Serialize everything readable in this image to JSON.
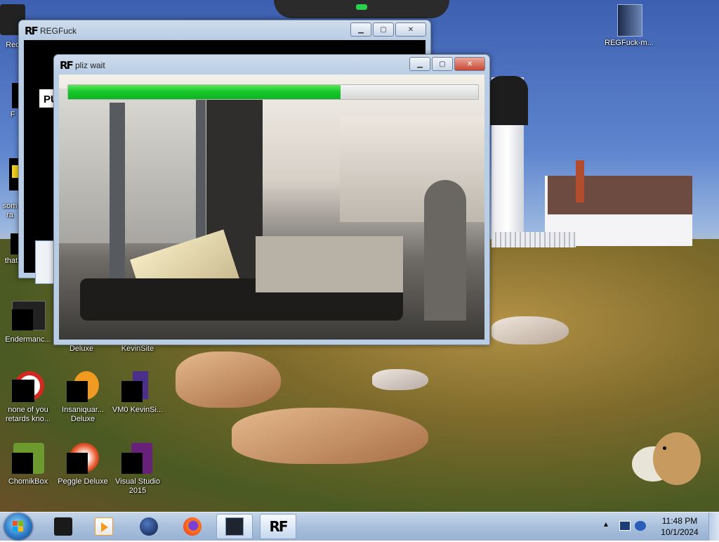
{
  "desktop": {
    "icons": [
      {
        "id": "rec",
        "label": "Rec"
      },
      {
        "id": "f",
        "label": "F"
      },
      {
        "id": "some",
        "label": "som\nra"
      },
      {
        "id": "that",
        "label": "that"
      },
      {
        "id": "enderman",
        "label": "Endermanc..."
      },
      {
        "id": "deluxe-top",
        "label": "Deluxe"
      },
      {
        "id": "kevinsite-top",
        "label": "KevinSite"
      },
      {
        "id": "none-of-you",
        "label": "none of you retards kno..."
      },
      {
        "id": "insaniquarium",
        "label": "Insaniquar... Deluxe"
      },
      {
        "id": "vm0",
        "label": "VM0 KevinSi..."
      },
      {
        "id": "chomikbox",
        "label": "ChomikBox"
      },
      {
        "id": "peggle",
        "label": "Peggle Deluxe"
      },
      {
        "id": "visual-studio",
        "label": "Visual Studio 2015"
      },
      {
        "id": "regfuck-m",
        "label": "REGFuck-m..."
      }
    ]
  },
  "windows": {
    "regfuck": {
      "title": "REGFuck",
      "icon_text": "RF",
      "pu_text": "PU"
    },
    "pliz": {
      "title": "pliz wait",
      "icon_text": "RF",
      "progress": 0.665
    }
  },
  "caption_buttons": {
    "minimize": "▁",
    "maximize": "▢",
    "close": "✕"
  },
  "taskbar": {
    "active_label": "RF",
    "clock_time": "11:48 PM",
    "clock_date": "10/1/2024",
    "colors": {
      "progress_green": "#16c92b"
    }
  }
}
